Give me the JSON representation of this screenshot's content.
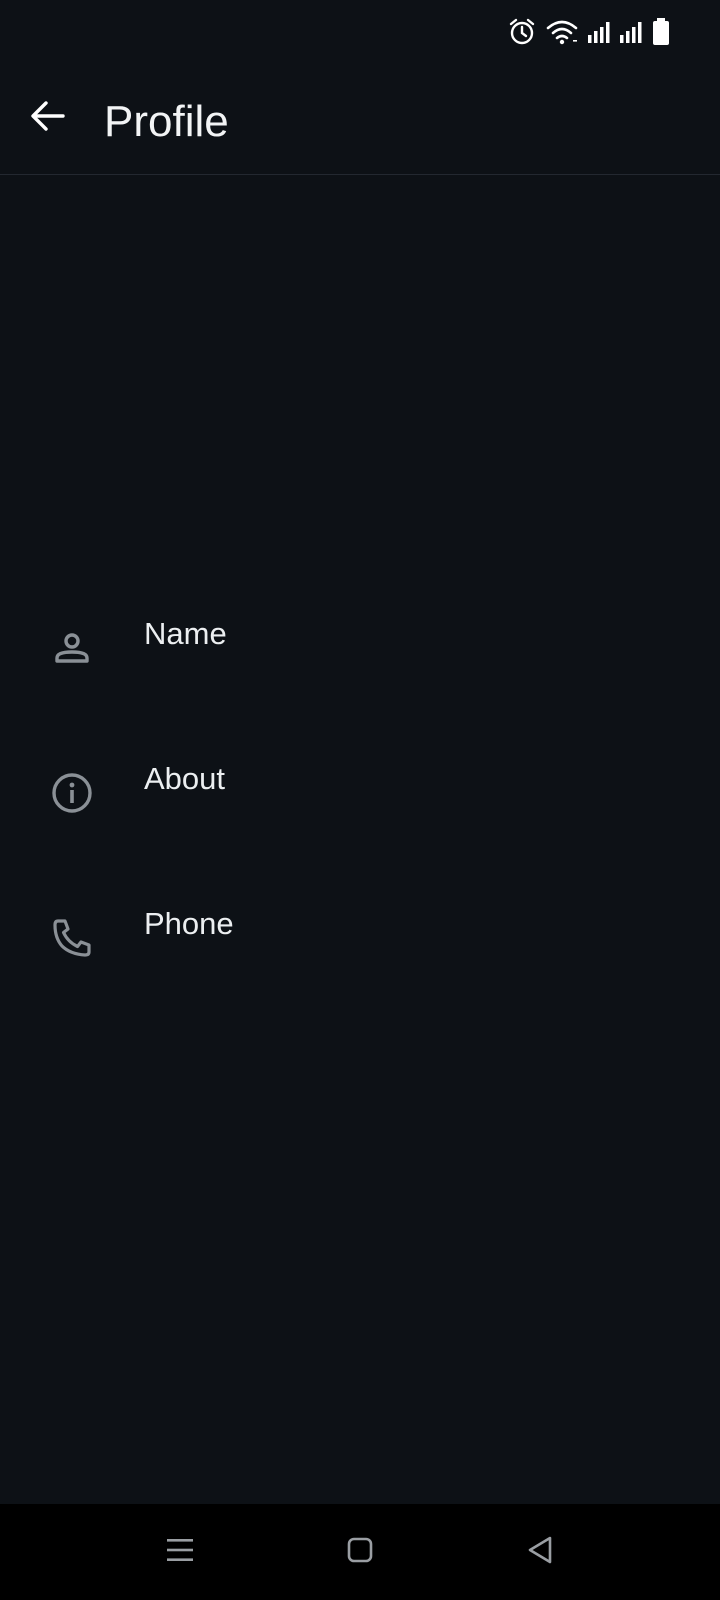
{
  "status_bar": {
    "icons": [
      "alarm-icon",
      "wifi-icon",
      "signal-1-icon",
      "signal-2-icon",
      "battery-icon"
    ]
  },
  "app_bar": {
    "title": "Profile",
    "back_icon": "arrow-back-icon"
  },
  "profile_items": [
    {
      "label": "Name",
      "icon": "person-icon"
    },
    {
      "label": "About",
      "icon": "info-icon"
    },
    {
      "label": "Phone",
      "icon": "phone-icon"
    }
  ],
  "nav_bar": {
    "buttons": [
      "menu-icon",
      "home-icon",
      "back-triangle-icon"
    ]
  },
  "colors": {
    "background": "#0d1116",
    "text": "#eceff1",
    "icon_muted": "#8a9096",
    "nav_background": "#000000"
  }
}
